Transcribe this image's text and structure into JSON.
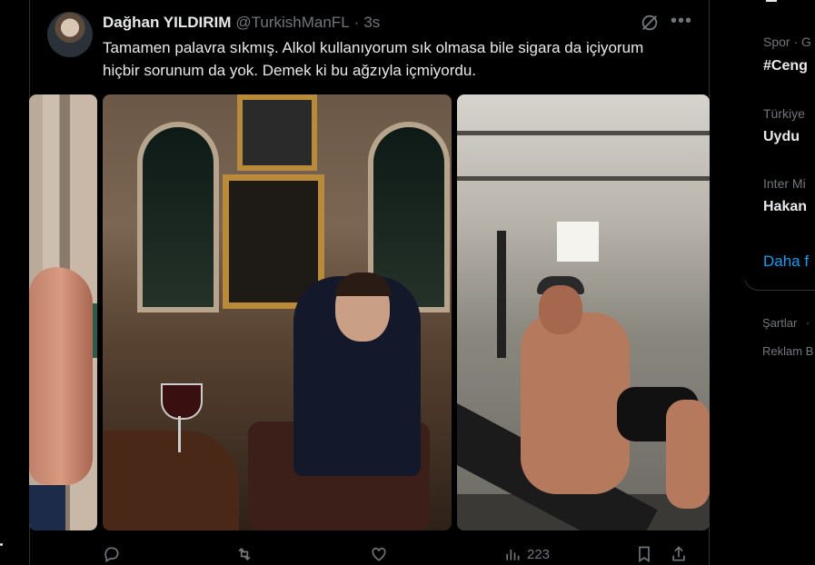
{
  "tweet": {
    "display_name": "Dağhan YILDIRIM",
    "handle": "@TurkishManFL",
    "separator": "·",
    "time": "3s",
    "text": "Tamamen palavra sıkmış. Alkol kullanıyorum sık olmasa bile sigara da içiyorum hiçbir sorunum da yok. Demek ki bu ağzıyla içmiyordu.",
    "actions": {
      "views": "223"
    }
  },
  "sidebar": {
    "trends": [
      {
        "meta": "Spor · G",
        "name": "#Ceng"
      },
      {
        "meta": "Türkiye",
        "name": "Uydu"
      },
      {
        "meta": "Inter Mi",
        "name": "Hakan"
      }
    ],
    "show_more": "Daha f",
    "footer": {
      "terms": "Şartlar",
      "bullet": "·",
      "ads": "Reklam B"
    }
  },
  "colors": {
    "background": "#000000",
    "text_primary": "#e7e9ea",
    "text_secondary": "#71767b",
    "accent": "#1d9bf0",
    "border": "#2f3336"
  }
}
